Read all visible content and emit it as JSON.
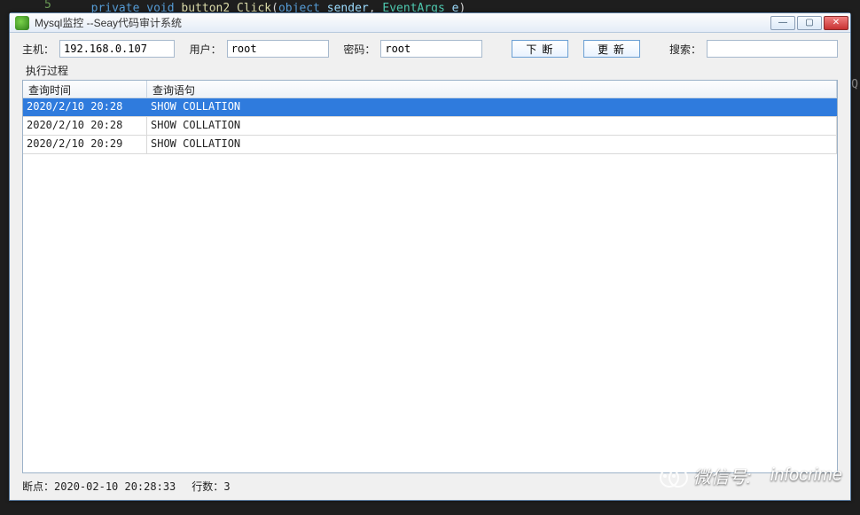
{
  "background_code": {
    "lineno": "5",
    "text_parts": {
      "kw1": "private",
      "kw2": "void",
      "fn": "button2_Click",
      "p_open": "(",
      "type1": "object",
      "arg1": "sender",
      "comma": ",",
      "type2": "EventArgs",
      "arg2": "e",
      "p_close": ")"
    }
  },
  "window": {
    "title": "Mysql监控 --Seay代码审计系统",
    "controls": {
      "min": "—",
      "max": "▢",
      "close": "✕"
    }
  },
  "form": {
    "host_label": "主机：",
    "host_value": "192.168.0.107",
    "user_label": "用户：",
    "user_value": "root",
    "pass_label": "密码：",
    "pass_value": "root",
    "break_button": "下断",
    "refresh_button": "更新",
    "search_label": "搜索：",
    "search_value": ""
  },
  "section_label": "执行过程",
  "grid": {
    "columns": {
      "time": "查询时间",
      "sql": "查询语句"
    },
    "rows": [
      {
        "time": "2020/2/10 20:28",
        "sql": "SHOW COLLATION",
        "selected": true
      },
      {
        "time": "2020/2/10 20:28",
        "sql": "SHOW COLLATION",
        "selected": false
      },
      {
        "time": "2020/2/10 20:29",
        "sql": "SHOW COLLATION",
        "selected": false
      }
    ]
  },
  "status": {
    "breakpoint_label": "断点：",
    "breakpoint_value": "2020-02-10 20:28:33",
    "rows_label": "行数：",
    "rows_value": "3"
  },
  "watermark": {
    "label": "微信号:",
    "value": "infocrime"
  },
  "gutter_char": "Q"
}
